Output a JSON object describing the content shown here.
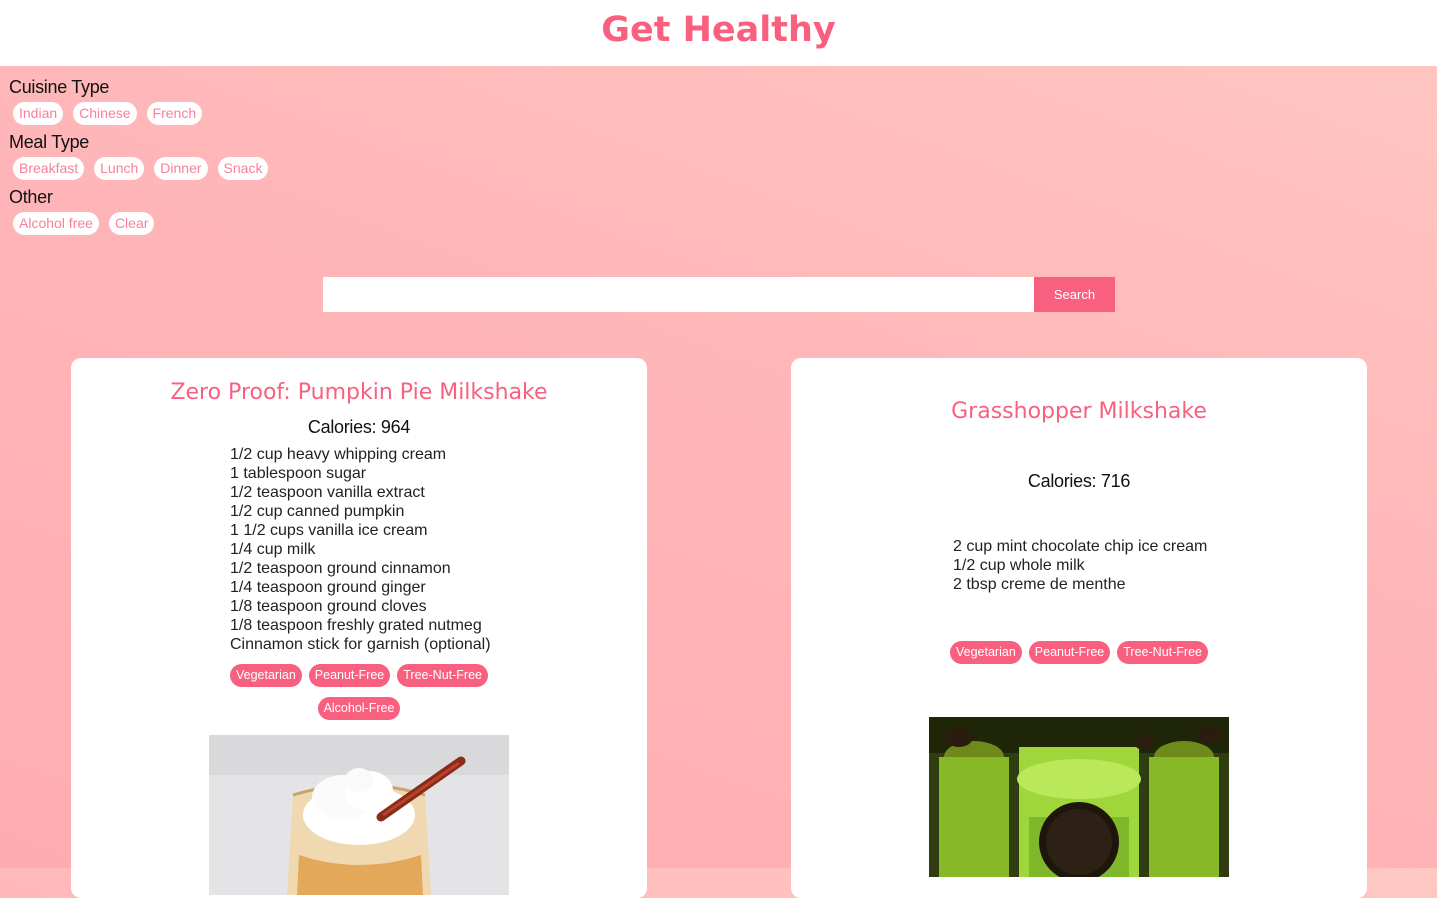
{
  "site_title": "Get Healthy",
  "filters": {
    "cuisine": {
      "label": "Cuisine Type",
      "options": [
        "Indian",
        "Chinese",
        "French"
      ]
    },
    "meal": {
      "label": "Meal Type",
      "options": [
        "Breakfast",
        "Lunch",
        "Dinner",
        "Snack"
      ]
    },
    "other": {
      "label": "Other",
      "options": [
        "Alcohol free",
        "Clear"
      ]
    }
  },
  "search": {
    "value": "",
    "placeholder": "",
    "button_label": "Search"
  },
  "recipes": [
    {
      "title": "Zero Proof: Pumpkin Pie Milkshake",
      "calories": "Calories: 964",
      "ingredients": [
        "1/2 cup heavy whipping cream",
        "1 tablespoon sugar",
        "1/2 teaspoon vanilla extract",
        "1/2 cup canned pumpkin",
        "1 1/2 cups vanilla ice cream",
        "1/4 cup milk",
        "1/2 teaspoon ground cinnamon",
        "1/4 teaspoon ground ginger",
        "1/8 teaspoon ground cloves",
        "1/8 teaspoon freshly grated nutmeg",
        "Cinnamon stick for garnish (optional)"
      ],
      "tags": [
        "Vegetarian",
        "Peanut-Free",
        "Tree-Nut-Free",
        "Alcohol-Free"
      ]
    },
    {
      "title": "Grasshopper Milkshake",
      "calories": "Calories: 716",
      "ingredients": [
        "2 cup mint chocolate chip ice cream",
        "1/2 cup whole milk",
        "2 tbsp creme de menthe"
      ],
      "tags": [
        "Vegetarian",
        "Peanut-Free",
        "Tree-Nut-Free"
      ]
    }
  ],
  "colors": {
    "accent": "#f9607f",
    "background": "#ffb6b8"
  }
}
